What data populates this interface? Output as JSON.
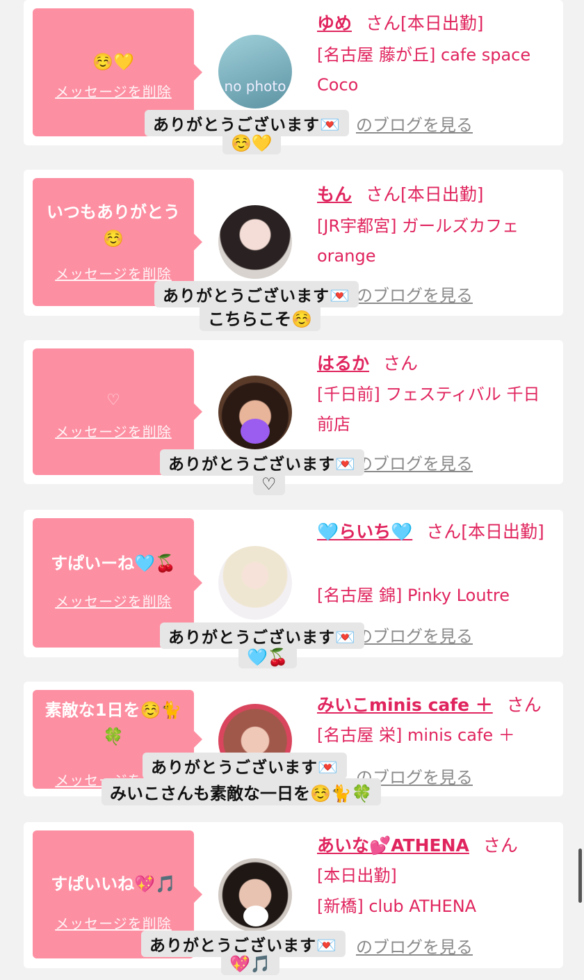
{
  "delete_label": "メッセージを削除",
  "blog_label": "のブログを見る",
  "san_label": "さん",
  "reply_header": "ありがとうございます💌",
  "colors": {
    "accent": "#e0245e",
    "bubble": "#fd8fa2",
    "background": "#f2f2f2"
  },
  "cards": [
    {
      "message": "☺️💛",
      "name": "ゆめ",
      "status": "[本日出勤]",
      "shop": "[名古屋 藤が丘] cafe space Coco",
      "reply_body": "☺️💛",
      "avatar": "no photo"
    },
    {
      "message": "いつもありがとう☺️",
      "name": "もん",
      "status": "[本日出勤]",
      "shop": "[JR宇都宮] ガールズカフェ orange",
      "reply_body": "こちらこそ☺️"
    },
    {
      "message": "♡",
      "name": "はるか",
      "status": "",
      "shop": "[千日前] フェスティバル 千日前店",
      "reply_body": "♡"
    },
    {
      "message": "すぱいーね🩵🍒",
      "name": "🩵らいち🩵",
      "status": "[本日出勤]",
      "shop": "[名古屋 錦] Pinky Loutre",
      "reply_body": "🩵🍒"
    },
    {
      "message": "素敵な1日を☺️🐈🍀",
      "name": "みいこminis cafe ＋",
      "status": "",
      "shop": "[名古屋 栄] minis cafe ＋",
      "reply_body": "みいこさんも素敵な一日を☺️🐈🍀"
    },
    {
      "message": "すぱいいね💖🎵",
      "name": "あいな💕ATHENA",
      "status": "[本日出勤]",
      "shop": "[新橋] club ATHENA",
      "reply_body": "💖🎵"
    }
  ]
}
